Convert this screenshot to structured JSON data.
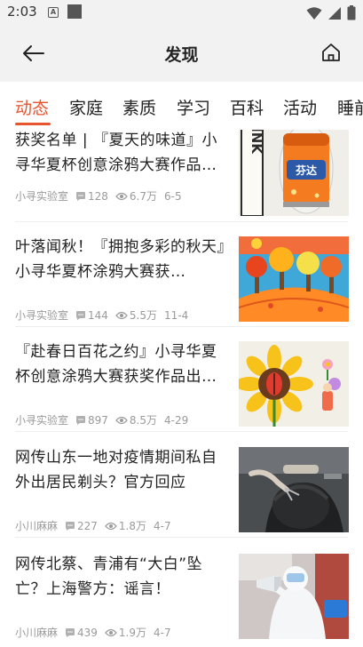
{
  "status": {
    "time": "2:03",
    "a_badge": "A"
  },
  "header": {
    "title": "发现"
  },
  "tabs": [
    "动态",
    "家庭",
    "素质",
    "学习",
    "百科",
    "活动",
    "睡前"
  ],
  "items": [
    {
      "title": "获奖名单 | 『夏天的味道』小寻华夏杯创意涂鸦大赛作品…",
      "author": "小寻实验室",
      "comments": "128",
      "views": "6.7万",
      "date": "6-5"
    },
    {
      "title": "叶落闻秋！『拥抱多彩的秋天』小寻华夏杯涂鸦大赛获…",
      "author": "小寻实验室",
      "comments": "144",
      "views": "5.5万",
      "date": "11-4"
    },
    {
      "title": "『赴春日百花之约』小寻华夏杯创意涂鸦大赛获奖作品出…",
      "author": "小寻实验室",
      "comments": "897",
      "views": "8.5万",
      "date": "4-29"
    },
    {
      "title": "网传山东一地对疫情期间私自外出居民剃头？官方回应",
      "author": "小川麻麻",
      "comments": "227",
      "views": "1.8万",
      "date": "4-7"
    },
    {
      "title": "网传北蔡、青浦有“大白”坠亡？上海警方：谣言！",
      "author": "小川麻麻",
      "comments": "439",
      "views": "1.9万",
      "date": "4-7"
    }
  ],
  "thumb_text": {
    "drink": "DRINK",
    "fanta": "芬达"
  },
  "colors": {
    "accent": "#e8542d",
    "header_bg": "#f2f2f2",
    "meta": "#9a9a9a"
  },
  "icons": {
    "back": "arrow-left-icon",
    "home": "home-icon",
    "comment": "comment-icon",
    "views": "eye-icon"
  }
}
